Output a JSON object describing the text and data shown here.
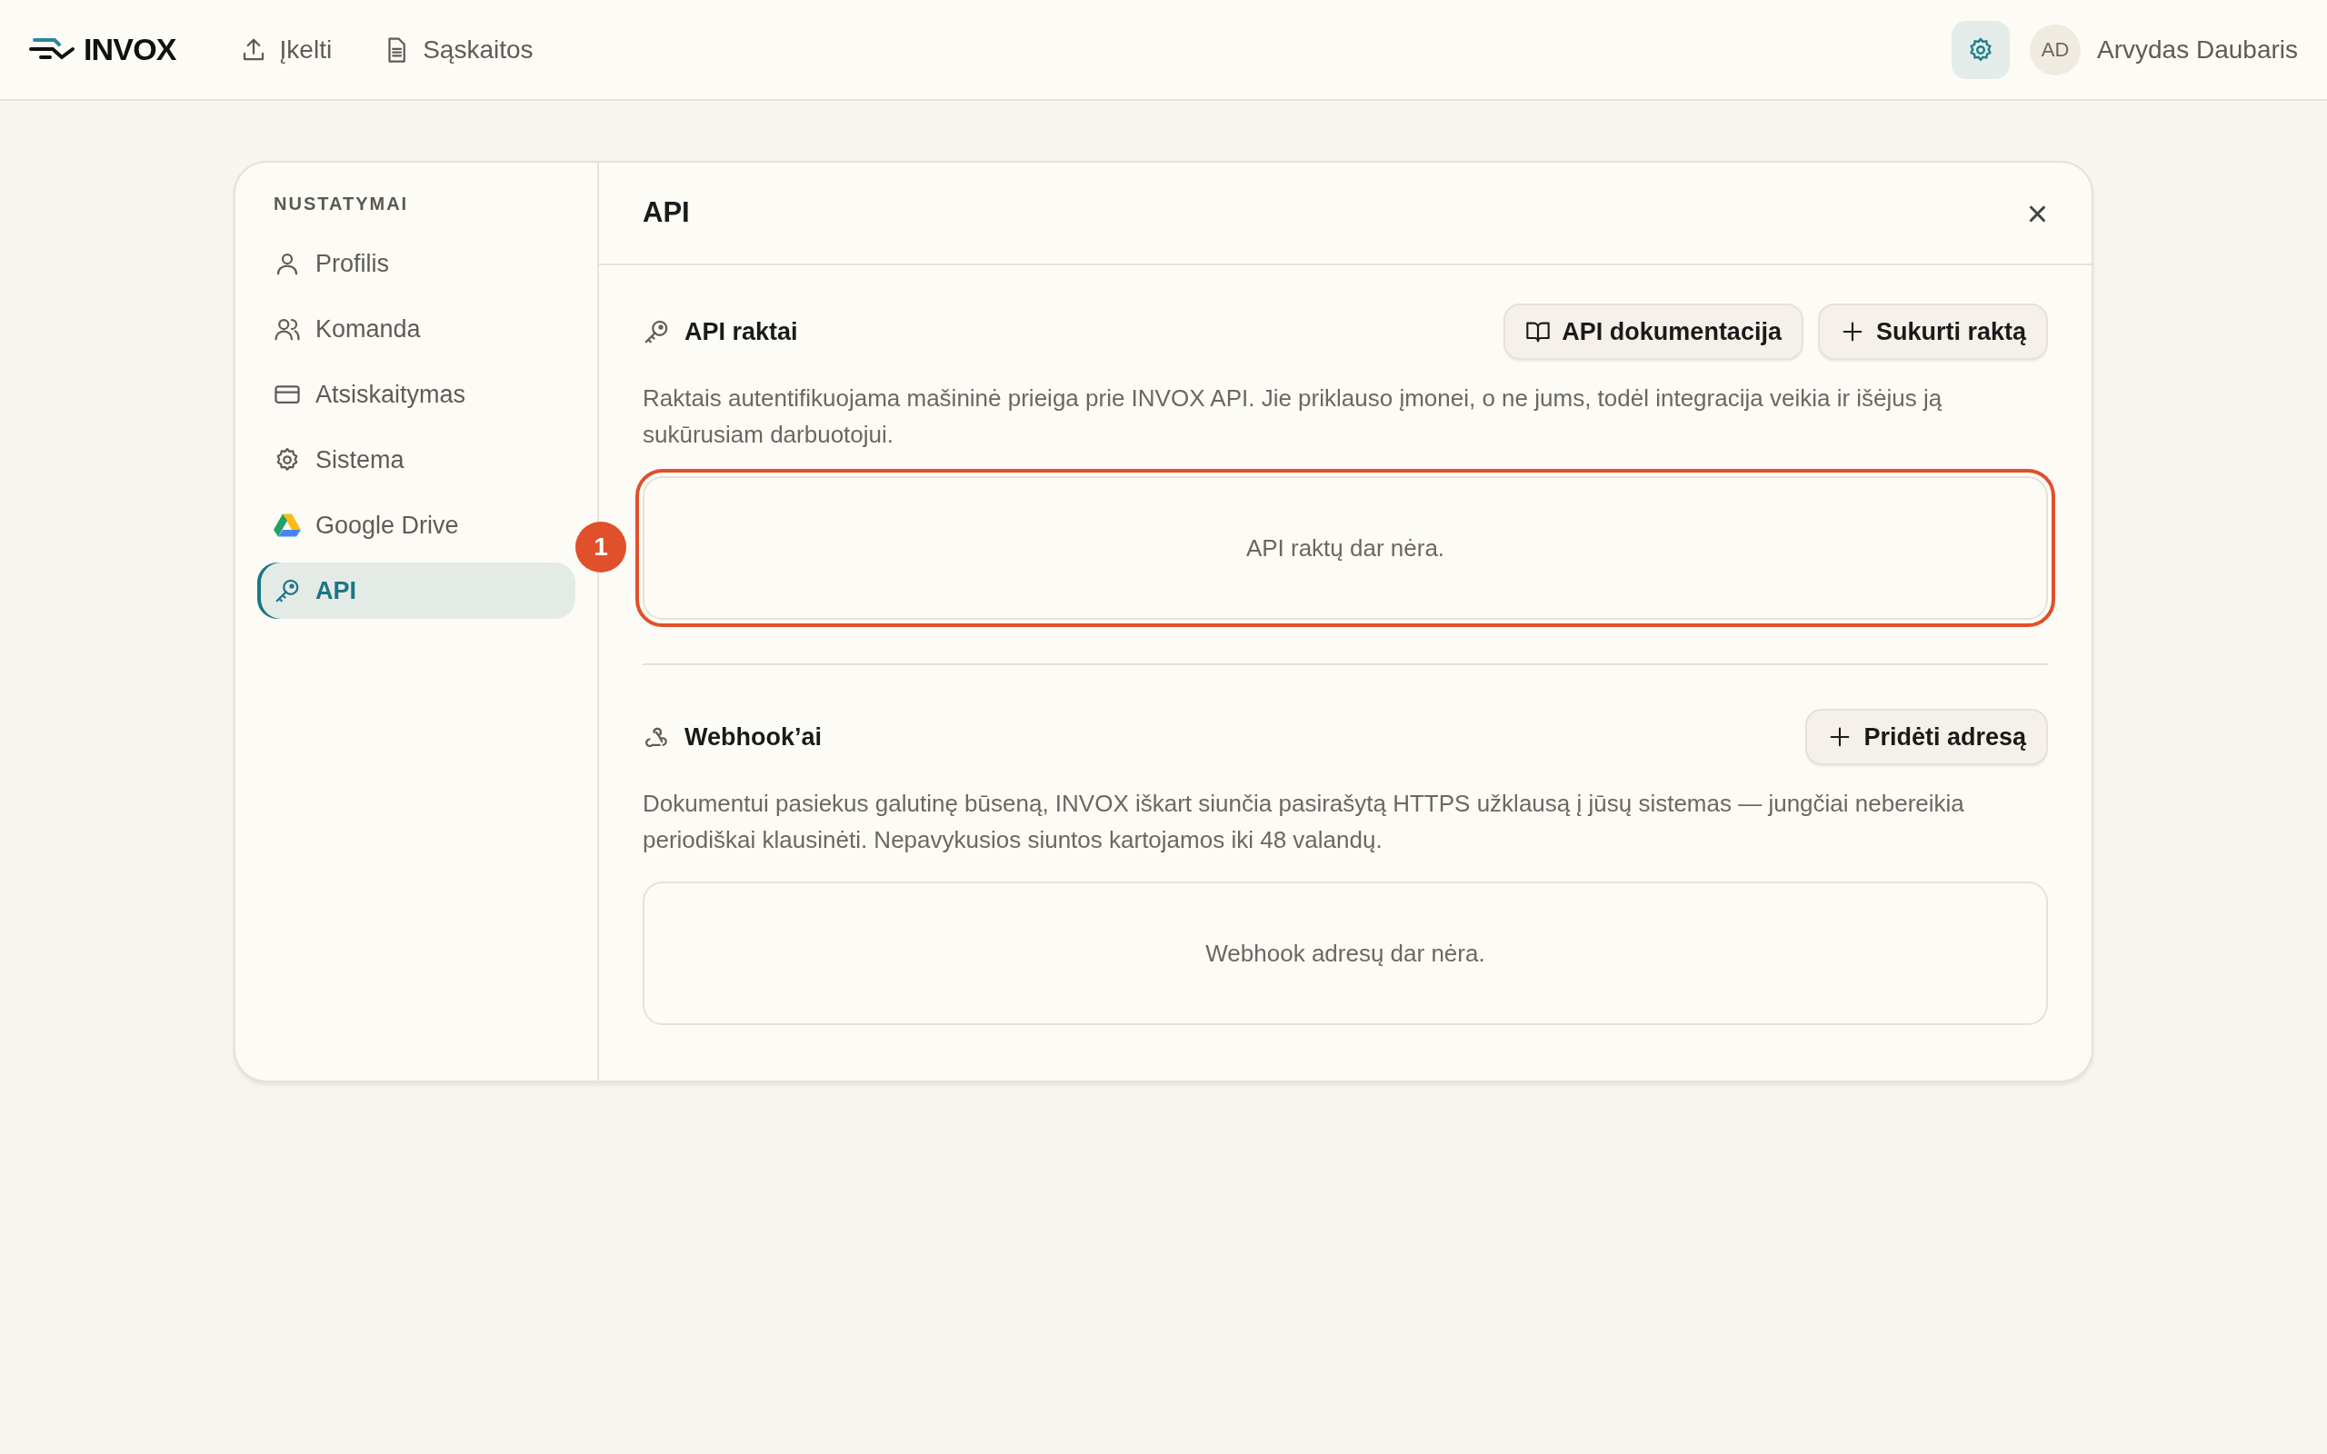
{
  "header": {
    "logo": "INVOX",
    "nav": [
      {
        "kind": "upload",
        "label": "Įkelti"
      },
      {
        "kind": "document",
        "label": "Sąskaitos"
      }
    ],
    "settings_active": true,
    "user": {
      "initials": "AD",
      "name": "Arvydas Daubaris"
    }
  },
  "sidebar": {
    "heading": "NUSTATYMAI",
    "items": [
      {
        "kind": "user",
        "label": "Profilis",
        "selected": false
      },
      {
        "kind": "users",
        "label": "Komanda",
        "selected": false
      },
      {
        "kind": "card",
        "label": "Atsiskaitymas",
        "selected": false
      },
      {
        "kind": "gear",
        "label": "Sistema",
        "selected": false
      },
      {
        "kind": "drive",
        "label": "Google Drive",
        "selected": false
      },
      {
        "kind": "key",
        "label": "API",
        "selected": true
      }
    ]
  },
  "panel": {
    "title": "API",
    "close": "×",
    "sections": [
      {
        "kind": "key",
        "title": "API raktai",
        "buttons": [
          {
            "kind": "book",
            "label": "API dokumentacija"
          },
          {
            "kind": "plus",
            "label": "Sukurti raktą"
          }
        ],
        "description": "Raktais autentifikuojama mašininė prieiga prie INVOX API. Jie priklauso įmonei, o ne jums, todėl integracija veikia ir išėjus ją sukūrusiam darbuotojui.",
        "empty": "API raktų dar nėra.",
        "highlighted": true,
        "marker": "1"
      },
      {
        "kind": "webhook",
        "title": "Webhook’ai",
        "buttons": [
          {
            "kind": "plus",
            "label": "Pridėti adresą"
          }
        ],
        "description": "Dokumentui pasiekus galutinę būseną, INVOX iškart siunčia pasirašytą HTTPS užklausą į jūsų sistemas — jungčiai nebereikia periodiškai klausinėti. Nepavykusios siuntos kartojamos iki 48 valandų.",
        "empty": "Webhook adresų dar nėra.",
        "highlighted": false
      }
    ]
  }
}
